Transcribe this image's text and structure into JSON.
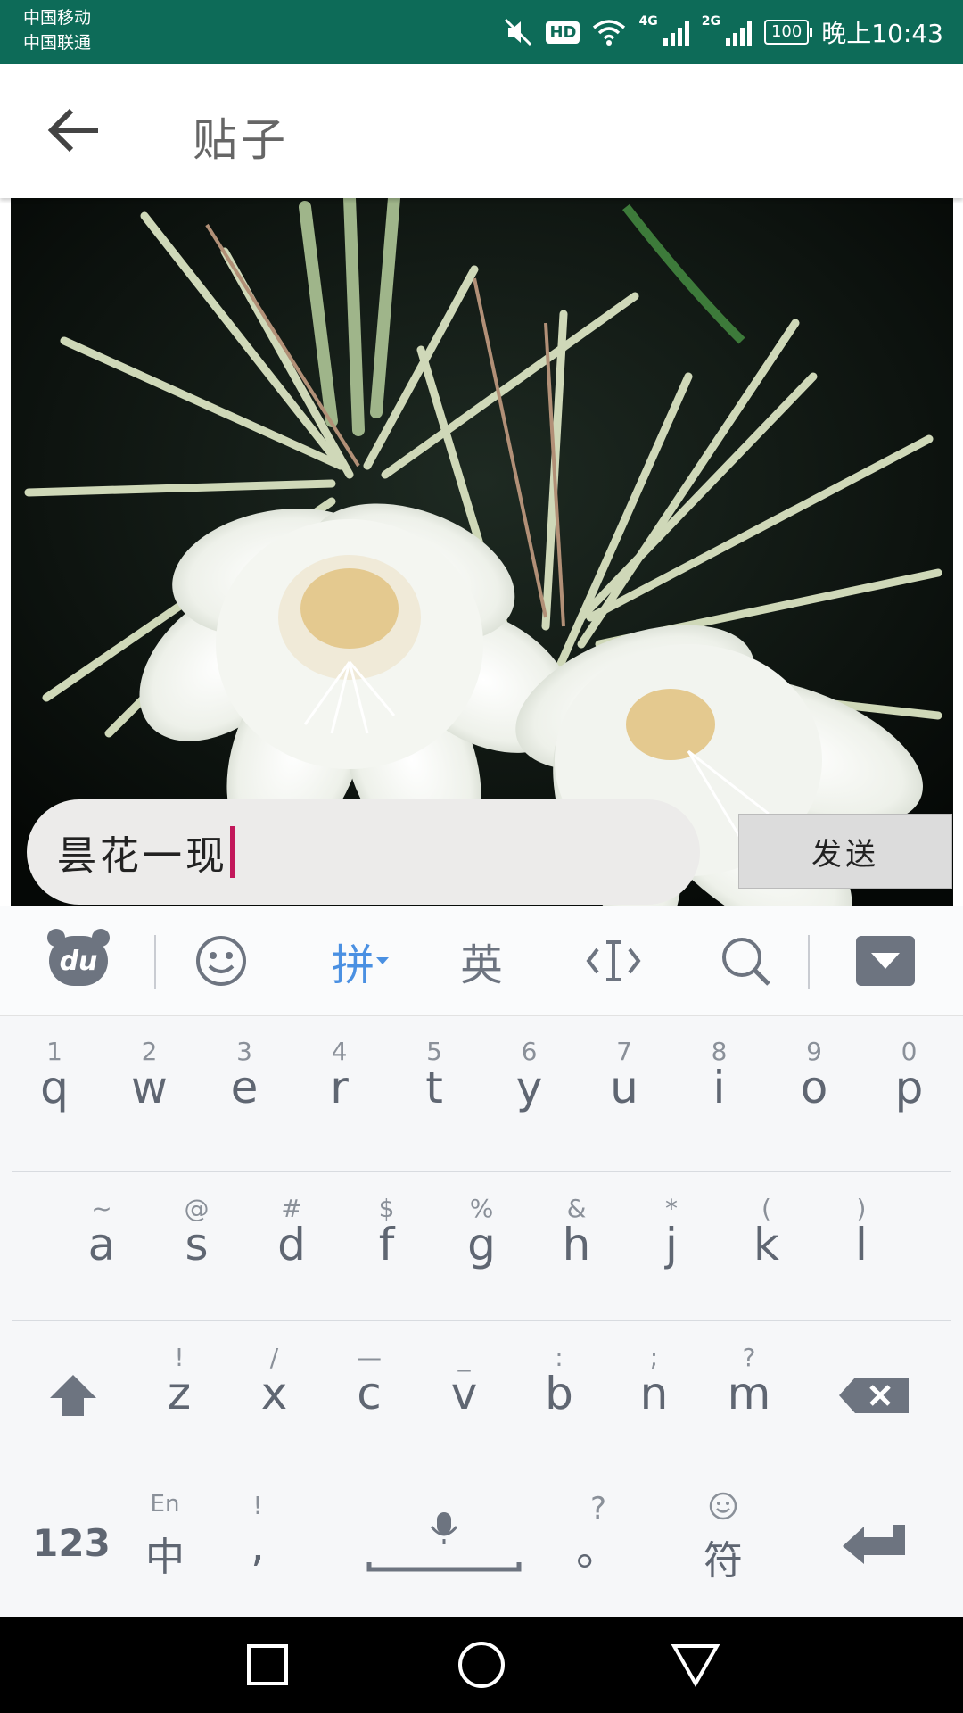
{
  "status_bar": {
    "carrier1": "中国移动",
    "carrier2": "中国联通",
    "hd": "HD",
    "net1": "4G",
    "net2": "2G",
    "battery": "100",
    "time": "晚上10:43"
  },
  "app_bar": {
    "title": "贴子"
  },
  "composer": {
    "input_value": "昙花一现",
    "send_label": "发送"
  },
  "keyboard": {
    "toolbar": {
      "logo": "du",
      "pinyin": "拼",
      "english": "英"
    },
    "row1": [
      {
        "sub": "1",
        "main": "q"
      },
      {
        "sub": "2",
        "main": "w"
      },
      {
        "sub": "3",
        "main": "e"
      },
      {
        "sub": "4",
        "main": "r"
      },
      {
        "sub": "5",
        "main": "t"
      },
      {
        "sub": "6",
        "main": "y"
      },
      {
        "sub": "7",
        "main": "u"
      },
      {
        "sub": "8",
        "main": "i"
      },
      {
        "sub": "9",
        "main": "o"
      },
      {
        "sub": "0",
        "main": "p"
      }
    ],
    "row2": [
      {
        "sub": "~",
        "main": "a"
      },
      {
        "sub": "@",
        "main": "s"
      },
      {
        "sub": "#",
        "main": "d"
      },
      {
        "sub": "$",
        "main": "f"
      },
      {
        "sub": "%",
        "main": "g"
      },
      {
        "sub": "&",
        "main": "h"
      },
      {
        "sub": "*",
        "main": "j"
      },
      {
        "sub": "(",
        "main": "k"
      },
      {
        "sub": ")",
        "main": "l"
      }
    ],
    "row3": [
      {
        "sub": "!",
        "main": "z"
      },
      {
        "sub": "/",
        "main": "x"
      },
      {
        "sub": "—",
        "main": "c"
      },
      {
        "sub": "_",
        "main": "v"
      },
      {
        "sub": ":",
        "main": "b"
      },
      {
        "sub": ";",
        "main": "n"
      },
      {
        "sub": "?",
        "main": "m"
      }
    ],
    "bottom": {
      "numbers": "123",
      "lang_sub": "En",
      "lang_main": "中",
      "comma_sub": "!",
      "comma_main": ",",
      "period_sub": "?",
      "period_main": "。",
      "symbols_main": "符"
    }
  }
}
